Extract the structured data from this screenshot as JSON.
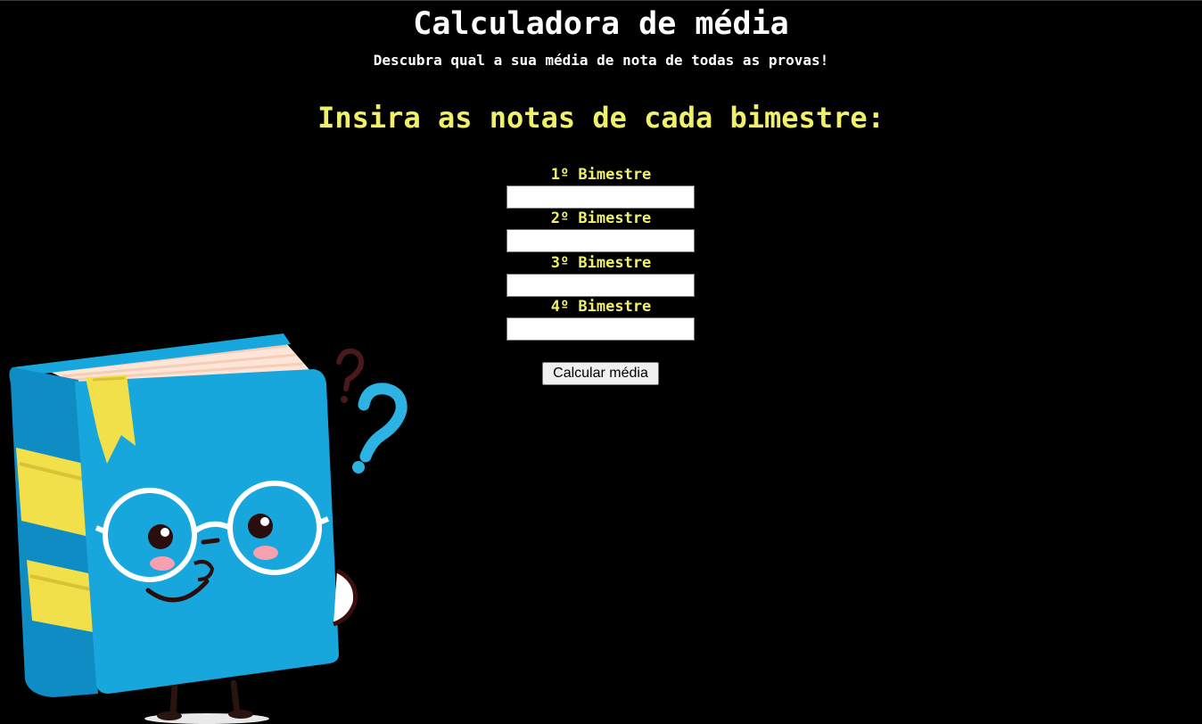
{
  "header": {
    "title": "Calculadora de média",
    "subtitle": "Descubra qual a sua média de nota de todas as provas!"
  },
  "form": {
    "heading": "Insira as notas de cada bimestre:",
    "fields": [
      {
        "label": "1º Bimestre",
        "value": ""
      },
      {
        "label": "2º Bimestre",
        "value": ""
      },
      {
        "label": "3º Bimestre",
        "value": ""
      },
      {
        "label": "4º Bimestre",
        "value": ""
      }
    ],
    "submit_label": "Calcular média"
  },
  "illustration": {
    "name": "book-mascot",
    "colors": {
      "cover": "#17a7dc",
      "spine": "#0f8cc4",
      "stripes": "#f2e04b",
      "pages": "#fde6d8",
      "question_dark": "#4a1a1a",
      "question_light": "#2db3e3"
    }
  },
  "theme": {
    "background": "#000000",
    "accent": "#f0f06a",
    "text": "#ffffff"
  }
}
